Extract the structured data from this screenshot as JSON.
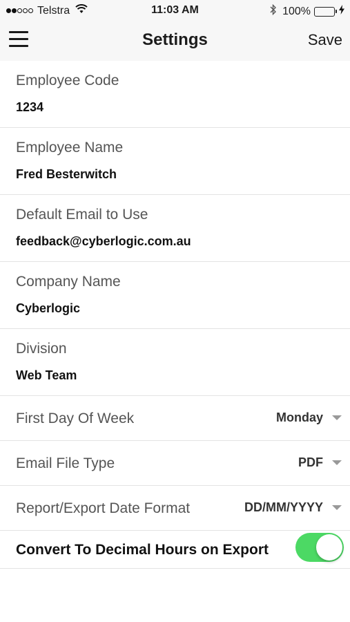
{
  "status_bar": {
    "carrier": "Telstra",
    "time": "11:03 AM",
    "battery": "100%",
    "signal_bars_filled": 2,
    "signal_bars_total": 5,
    "icons": [
      "wifi-icon",
      "bluetooth-icon",
      "battery-icon",
      "charging-bolt-icon"
    ]
  },
  "nav": {
    "title": "Settings",
    "save_label": "Save",
    "menu_icon": "hamburger-menu-icon"
  },
  "fields": [
    {
      "label": "Employee Code",
      "value": "1234"
    },
    {
      "label": "Employee Name",
      "value": "Fred Besterwitch"
    },
    {
      "label": "Default Email to Use",
      "value": "feedback@cyberlogic.com.au"
    },
    {
      "label": "Company Name",
      "value": "Cyberlogic"
    },
    {
      "label": "Division",
      "value": "Web Team"
    }
  ],
  "selects": [
    {
      "label": "First Day Of Week",
      "value": "Monday"
    },
    {
      "label": "Email File Type",
      "value": "PDF"
    },
    {
      "label": "Report/Export Date Format",
      "value": "DD/MM/YYYY"
    }
  ],
  "toggle": {
    "label": "Convert To Decimal Hours on Export",
    "on": true
  },
  "colors": {
    "accent_green": "#4cd964",
    "bar_background": "#f7f7f7",
    "label_gray": "#555555"
  }
}
